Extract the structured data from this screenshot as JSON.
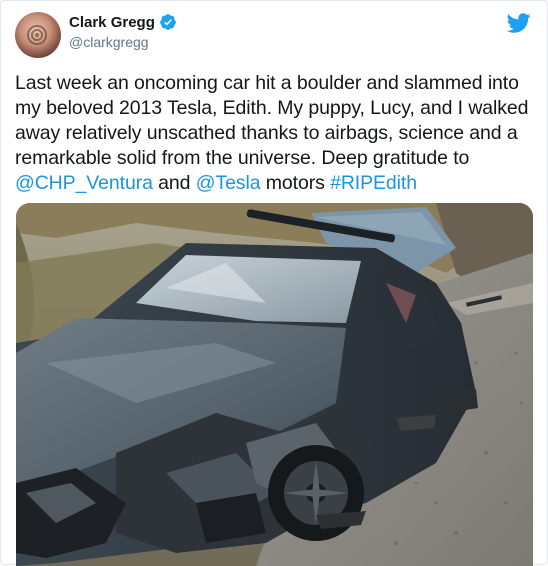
{
  "user": {
    "display_name": "Clark Gregg",
    "handle": "@clarkgregg",
    "verified": true
  },
  "tweet": {
    "text_part1": "Last week an oncoming car hit a boulder and slammed into my beloved 2013 Tesla, Edith. My puppy, Lucy, and I walked away relatively unscathed thanks to airbags, science and a remarkable solid from the universe. Deep gratitude to ",
    "mention1": "@CHP_Ventura",
    "text_part2": " and ",
    "mention2": "@Tesla",
    "text_part3": " motors  ",
    "hashtag": "#RIPEdith"
  },
  "icons": {
    "avatar": "avatar-image",
    "verified": "verified-badge-icon",
    "brand": "twitter-bird-icon"
  },
  "colors": {
    "link": "#1b95e0",
    "brand": "#1da1f2",
    "text": "#14171a",
    "secondary": "#657786"
  }
}
